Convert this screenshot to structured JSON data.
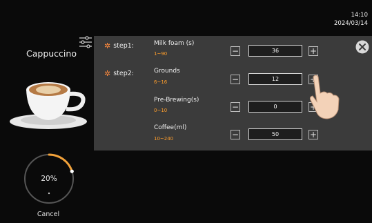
{
  "status": {
    "time": "14:10",
    "date": "2024/03/14"
  },
  "drink": {
    "name": "Cappuccino"
  },
  "progress": {
    "label": "20%",
    "fraction": 0.2,
    "cancel_label": "Cancel"
  },
  "steps": [
    {
      "label": "step1:"
    },
    {
      "label": "step2:"
    }
  ],
  "params": [
    {
      "name": "Milk foam (s)",
      "range": "1~90",
      "value": "36"
    },
    {
      "name": "Grounds",
      "range": "6~16",
      "value": "12"
    },
    {
      "name": "Pre-Brewing(s)",
      "range": "0~10",
      "value": "0"
    },
    {
      "name": "Coffee(ml)",
      "range": "10~240",
      "value": "50"
    }
  ],
  "controls": {
    "minus": "−",
    "plus": "+"
  },
  "colors": {
    "accent": "#ff9e2c",
    "panel": "#3b3b3b",
    "background": "#0a0a0a"
  },
  "icons": {
    "settings": "sliders-icon",
    "close": "close-icon",
    "step": "gear-dot-icon"
  }
}
